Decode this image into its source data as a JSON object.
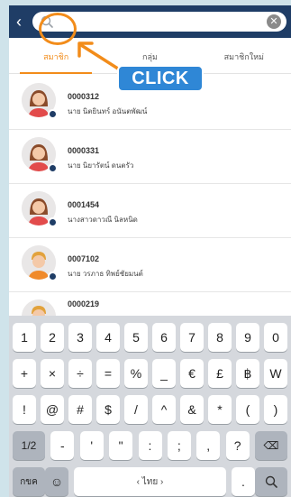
{
  "search": {
    "value": "",
    "placeholder": "",
    "cursor": "I"
  },
  "tabs": [
    {
      "label": "สมาชิก",
      "active": true
    },
    {
      "label": "กลุ่ม",
      "active": false
    },
    {
      "label": "สมาชิกใหม่",
      "active": false
    }
  ],
  "contacts": [
    {
      "code": "0000312",
      "name": "นาย นิตยินทร์  อนันตพัฒน์",
      "avatar": "female"
    },
    {
      "code": "0000331",
      "name": "นาย นิยารัตน์  ดนตรัว",
      "avatar": "female"
    },
    {
      "code": "0001454",
      "name": "นางสาวดาวณี  นิลหนิด",
      "avatar": "female"
    },
    {
      "code": "0007102",
      "name": "นาย วรภาธ  ทิพย์ชัยมนต์",
      "avatar": "male"
    },
    {
      "code": "0000219",
      "name": "",
      "avatar": "male"
    }
  ],
  "callout": {
    "label": "CLICK"
  },
  "keyboard": {
    "row1": [
      "1",
      "2",
      "3",
      "4",
      "5",
      "6",
      "7",
      "8",
      "9",
      "0"
    ],
    "row2": [
      "+",
      "×",
      "÷",
      "=",
      "%",
      "_",
      "€",
      "£",
      "฿",
      "W"
    ],
    "row3": [
      "!",
      "@",
      "#",
      "$",
      "/",
      "^",
      "&",
      "*",
      "(",
      ")"
    ],
    "row4": {
      "mode": "1/2",
      "keys": [
        "-",
        "'",
        "\"",
        ":",
        ";",
        ",",
        "?"
      ],
      "backspace": "⌫"
    },
    "row5": {
      "lang": "กขค",
      "emoji": "☺",
      "space": "‹ ไทย ›",
      "dot": ".",
      "search": "⚲"
    }
  },
  "colors": {
    "header": "#1f3d66",
    "accent": "#f28c1a",
    "badge": "#2f87d6"
  }
}
